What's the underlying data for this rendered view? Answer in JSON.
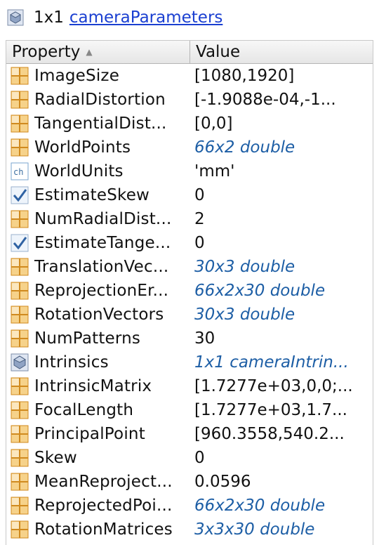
{
  "title": {
    "size": "1x1",
    "class_name": "cameraParameters"
  },
  "columns": {
    "property": "Property",
    "value": "Value"
  },
  "rows": [
    {
      "icon": "matrix-icon",
      "name": "ImageSize",
      "value": "[1080,1920]",
      "link": false
    },
    {
      "icon": "matrix-icon",
      "name": "RadialDistortion",
      "value": "[-1.9088e-04,-1...",
      "link": false
    },
    {
      "icon": "matrix-icon",
      "name": "TangentialDist...",
      "value": "[0,0]",
      "link": false
    },
    {
      "icon": "matrix-icon",
      "name": "WorldPoints",
      "value": "66x2 double",
      "link": true
    },
    {
      "icon": "char-icon",
      "name": "WorldUnits",
      "value": "'mm'",
      "link": false
    },
    {
      "icon": "logical-icon",
      "name": "EstimateSkew",
      "value": "0",
      "link": false
    },
    {
      "icon": "matrix-icon",
      "name": "NumRadialDist...",
      "value": "2",
      "link": false
    },
    {
      "icon": "logical-icon",
      "name": "EstimateTange...",
      "value": "0",
      "link": false
    },
    {
      "icon": "matrix-icon",
      "name": "TranslationVec...",
      "value": "30x3 double",
      "link": true
    },
    {
      "icon": "matrix-icon",
      "name": "ReprojectionEr...",
      "value": "66x2x30 double",
      "link": true
    },
    {
      "icon": "matrix-icon",
      "name": "RotationVectors",
      "value": "30x3 double",
      "link": true
    },
    {
      "icon": "matrix-icon",
      "name": "NumPatterns",
      "value": "30",
      "link": false
    },
    {
      "icon": "object-icon",
      "name": "Intrinsics",
      "value": "1x1 cameraIntrin...",
      "link": true
    },
    {
      "icon": "matrix-icon",
      "name": "IntrinsicMatrix",
      "value": "[1.7277e+03,0,0;...",
      "link": false
    },
    {
      "icon": "matrix-icon",
      "name": "FocalLength",
      "value": "[1.7277e+03,1.7...",
      "link": false
    },
    {
      "icon": "matrix-icon",
      "name": "PrincipalPoint",
      "value": "[960.3558,540.2...",
      "link": false
    },
    {
      "icon": "matrix-icon",
      "name": "Skew",
      "value": "0",
      "link": false
    },
    {
      "icon": "matrix-icon",
      "name": "MeanReproject...",
      "value": "0.0596",
      "link": false
    },
    {
      "icon": "matrix-icon",
      "name": "ReprojectedPoi...",
      "value": "66x2x30 double",
      "link": true
    },
    {
      "icon": "matrix-icon",
      "name": "RotationMatrices",
      "value": "3x3x30 double",
      "link": true
    }
  ],
  "colors": {
    "link": "#1a3fd1",
    "value_link": "#1d5ea5",
    "matrix_icon": "#e8a33a"
  }
}
